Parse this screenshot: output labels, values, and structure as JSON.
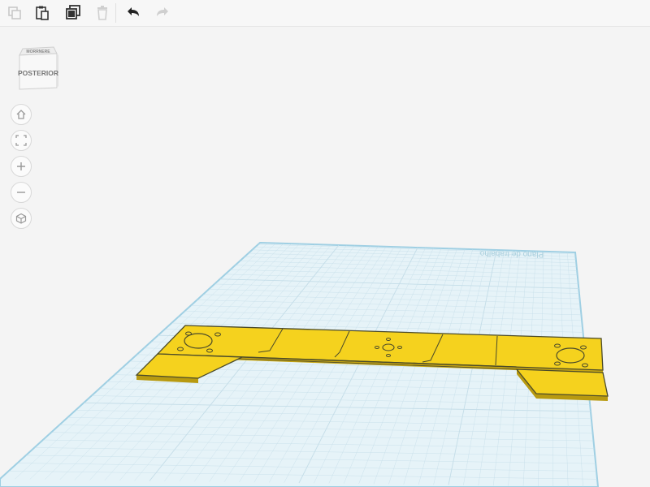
{
  "toolbar": {
    "items": [
      {
        "name": "copy",
        "icon": "copy-icon",
        "enabled": false
      },
      {
        "name": "paste",
        "icon": "paste-icon",
        "enabled": true
      },
      {
        "name": "duplicate",
        "icon": "duplicate-icon",
        "enabled": true
      },
      {
        "name": "delete",
        "icon": "trash-icon",
        "enabled": false
      },
      {
        "name": "undo",
        "icon": "undo-icon",
        "enabled": true
      },
      {
        "name": "redo",
        "icon": "redo-icon",
        "enabled": false
      }
    ]
  },
  "viewcube": {
    "top_label": "MORRNERE",
    "front_label": "POSTERIOR"
  },
  "nav": [
    {
      "name": "home",
      "icon": "home-icon"
    },
    {
      "name": "fit",
      "icon": "fit-view-icon"
    },
    {
      "name": "zoom-in",
      "icon": "zoom-in-icon"
    },
    {
      "name": "zoom-out",
      "icon": "zoom-out-icon"
    },
    {
      "name": "perspective",
      "icon": "cube-view-icon"
    }
  ],
  "workplane": {
    "label": "Plano de trabalho"
  },
  "colors": {
    "part": "#f5d21e",
    "part_edge": "#4a4a2a",
    "workplane": "#e6f3f8",
    "grid": "#c4dde8",
    "workplane_edge": "#9fcfe3"
  }
}
